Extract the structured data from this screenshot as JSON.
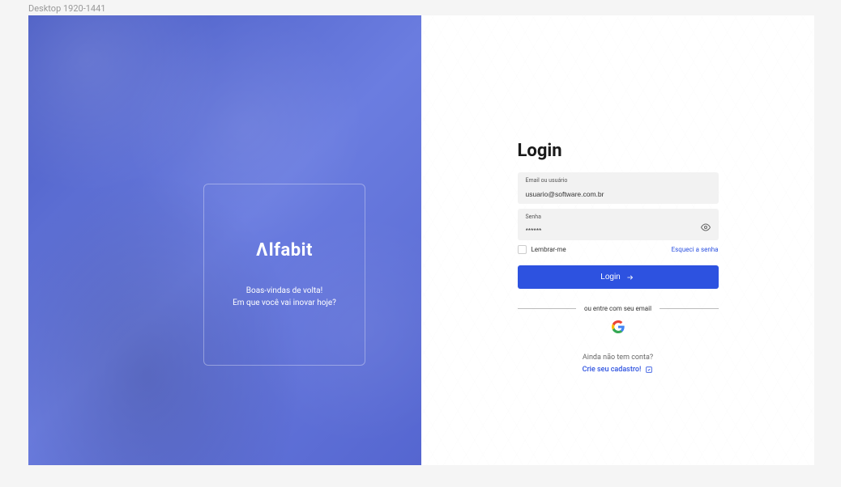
{
  "frame_label": "Desktop 1920-1441",
  "brand": {
    "name": "Alfabit",
    "welcome_line1": "Boas-vindas de volta!",
    "welcome_line2": "Em que você vai inovar hoje?"
  },
  "form": {
    "title": "Login",
    "email": {
      "label": "Email ou usuário",
      "value": "usuario@software.com.br"
    },
    "password": {
      "label": "Senha",
      "value": "******"
    },
    "remember_label": "Lembrar-me",
    "forgot_label": "Esqueci a senha",
    "submit_label": "Login",
    "divider_text": "ou entre com seu email",
    "no_account_text": "Ainda não tem conta?",
    "signup_label": "Crie seu cadastro!"
  },
  "colors": {
    "primary": "#2d52e0",
    "panel_blue": "#5b6fd8"
  }
}
